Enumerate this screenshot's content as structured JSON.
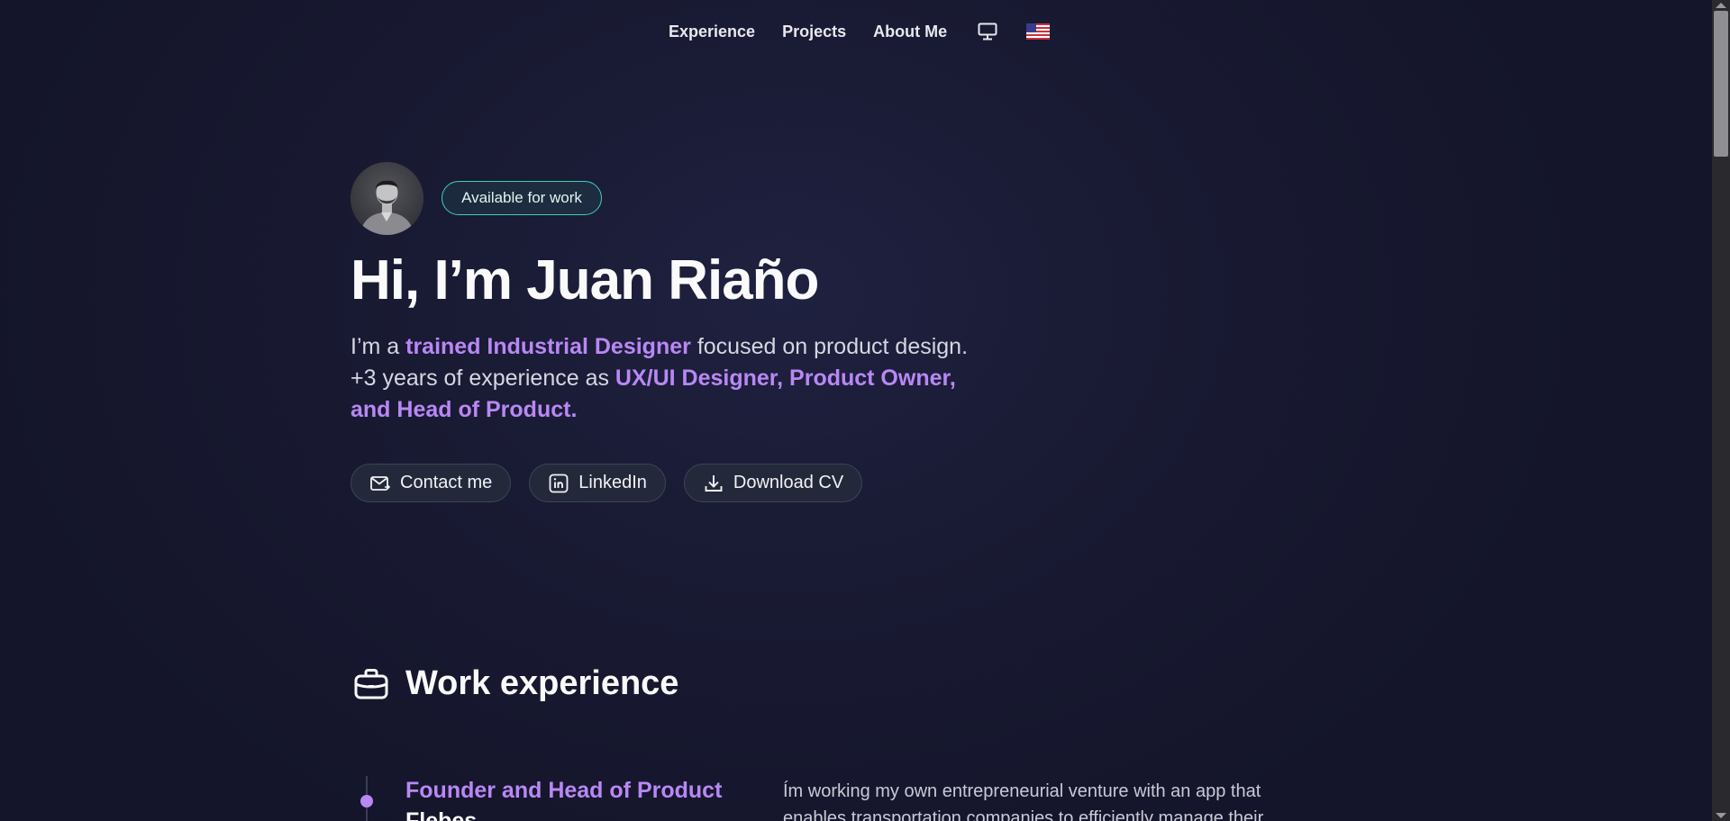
{
  "nav": {
    "items": [
      {
        "label": "Experience"
      },
      {
        "label": "Projects"
      },
      {
        "label": "About Me"
      }
    ],
    "theme_icon": "monitor-icon",
    "language_icon": "us-flag-icon"
  },
  "hero": {
    "avatar_icon": "profile-photo",
    "badge": "Available for work",
    "title": "Hi, I’m Juan Riaño",
    "intro": {
      "part1": "I’m a ",
      "highlight1": "trained Industrial Designer",
      "part2": " focused on product design. +3 years of experience as ",
      "highlight2": "UX/UI Designer, Product Owner, and Head of Product."
    },
    "buttons": {
      "contact": "Contact me",
      "linkedin": "LinkedIn",
      "download": "Download CV"
    }
  },
  "experience": {
    "heading": "Work experience",
    "items": [
      {
        "role": "Founder and Head of Product",
        "company": "Flebes",
        "description": "Ím working my own entrepreneurial venture with an app that enables transportation companies to efficiently manage their"
      }
    ]
  },
  "colors": {
    "accent": "#b888f4",
    "badge_border": "#3fd0b6",
    "background": "#191a33"
  }
}
